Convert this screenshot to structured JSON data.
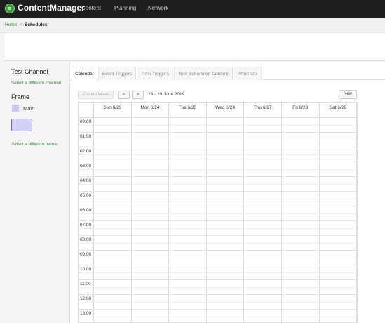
{
  "app": {
    "brand": "ContentManager"
  },
  "topnav": {
    "items": [
      {
        "label": "Content"
      },
      {
        "label": "Planning"
      },
      {
        "label": "Network"
      }
    ]
  },
  "breadcrumb": {
    "home": "Home",
    "separator": ">",
    "current": "Schedules"
  },
  "sidebar": {
    "channel_title": "Test Channel",
    "change_channel": "Select a different channel",
    "frame_heading": "Frame",
    "frame_name": "Main",
    "frame_color": "#c9c5f2",
    "change_frame": "Select a different frame"
  },
  "tabs": [
    {
      "label": "Calendar",
      "active": true
    },
    {
      "label": "Event Triggers",
      "active": false
    },
    {
      "label": "Time Triggers",
      "active": false
    },
    {
      "label": "Non-Scheduled Content",
      "active": false
    },
    {
      "label": "Alternate",
      "active": false
    }
  ],
  "toolbar": {
    "current_week": "Current Week",
    "prev": "<",
    "next": ">",
    "date_range": "23 - 29 June 2019",
    "new": "New"
  },
  "calendar": {
    "days": [
      "Sun 6/23",
      "Mon 6/24",
      "Tue 6/25",
      "Wed 6/26",
      "Thu 6/27",
      "Fri 6/28",
      "Sat 6/29"
    ],
    "hours": [
      "00:00",
      "01:00",
      "02:00",
      "03:00",
      "04:00",
      "05:00",
      "06:00",
      "07:00",
      "08:00",
      "09:00",
      "10:00",
      "11:00",
      "12:00",
      "13:00"
    ]
  },
  "colors": {
    "accent": "#2c8a2c",
    "topbar": "#1e1e1e"
  }
}
